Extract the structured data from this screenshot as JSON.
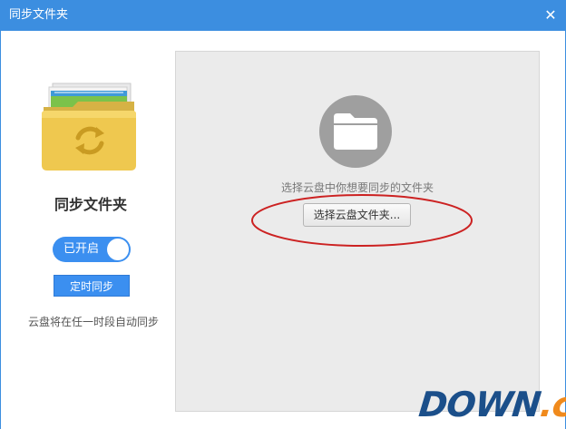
{
  "window": {
    "title": "同步文件夹",
    "close_icon": "close-icon",
    "title_bar_color": "#3c8ee0"
  },
  "sidebar": {
    "illustration_icon": "sync-folder-icon",
    "title": "同步文件夹",
    "toggle": {
      "label": "已开启",
      "state": "on",
      "color": "#3b8ff0"
    },
    "schedule_button": {
      "label": "定时同步"
    },
    "note": "云盘将在任一时段自动同步"
  },
  "main": {
    "icon": "folder-icon",
    "prompt": "选择云盘中你想要同步的文件夹",
    "select_button": {
      "label": "选择云盘文件夹..."
    },
    "annotation_color": "#cc2222"
  },
  "watermark": {
    "text_main": "DOWN",
    "text_accent": ".cc",
    "main_color": "#1b4f8a",
    "accent_color": "#f08a1c"
  }
}
